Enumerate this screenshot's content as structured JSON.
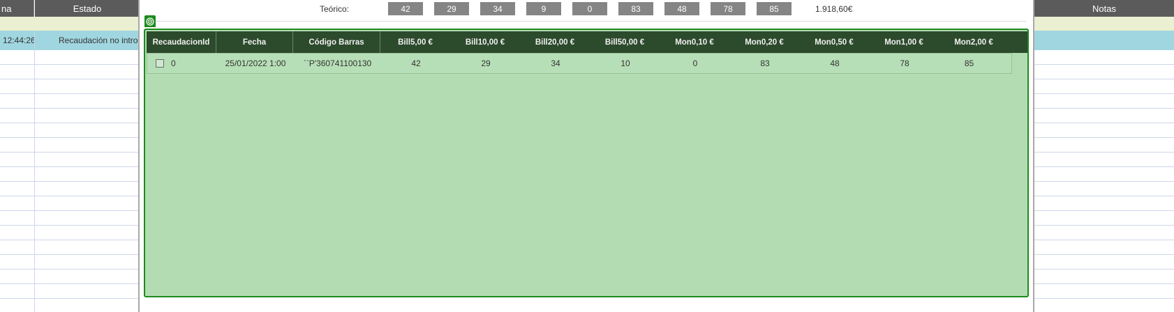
{
  "background_list": {
    "headers": {
      "left_col1": "na",
      "left_col2": "Estado",
      "right_col": "Notas"
    },
    "selected_row": {
      "time": "12:44:26",
      "estado": "Recaudación no introduc"
    }
  },
  "teorico": {
    "label": "Teórico:",
    "values": [
      "42",
      "29",
      "34",
      "9",
      "0",
      "83",
      "48",
      "78",
      "85"
    ],
    "total": "1.918,60€"
  },
  "grid": {
    "columns": [
      "RecaudacionId",
      "Fecha",
      "Código Barras",
      "Bill5,00 €",
      "Bill10,00 €",
      "Bill20,00 €",
      "Bill50,00 €",
      "Mon0,10 €",
      "Mon0,20 €",
      "Mon0,50 €",
      "Mon1,00 €",
      "Mon2,00 €"
    ],
    "rows": [
      {
        "id": "0",
        "fecha": "25/01/2022 1:00",
        "codigo": "``P'360741100130",
        "bill5": "42",
        "bill10": "29",
        "bill20": "34",
        "bill50": "10",
        "mon010": "0",
        "mon020": "83",
        "mon050": "48",
        "mon100": "78",
        "mon200": "85"
      }
    ]
  },
  "colors": {
    "panel_bg": "#b3dcb3",
    "panel_border": "#1d8a1d",
    "grid_header": "#2c4a2c",
    "selected_row": "#a0d6e0",
    "teorico_box": "#858585"
  },
  "icons": {
    "panel_handle": "target-icon"
  }
}
